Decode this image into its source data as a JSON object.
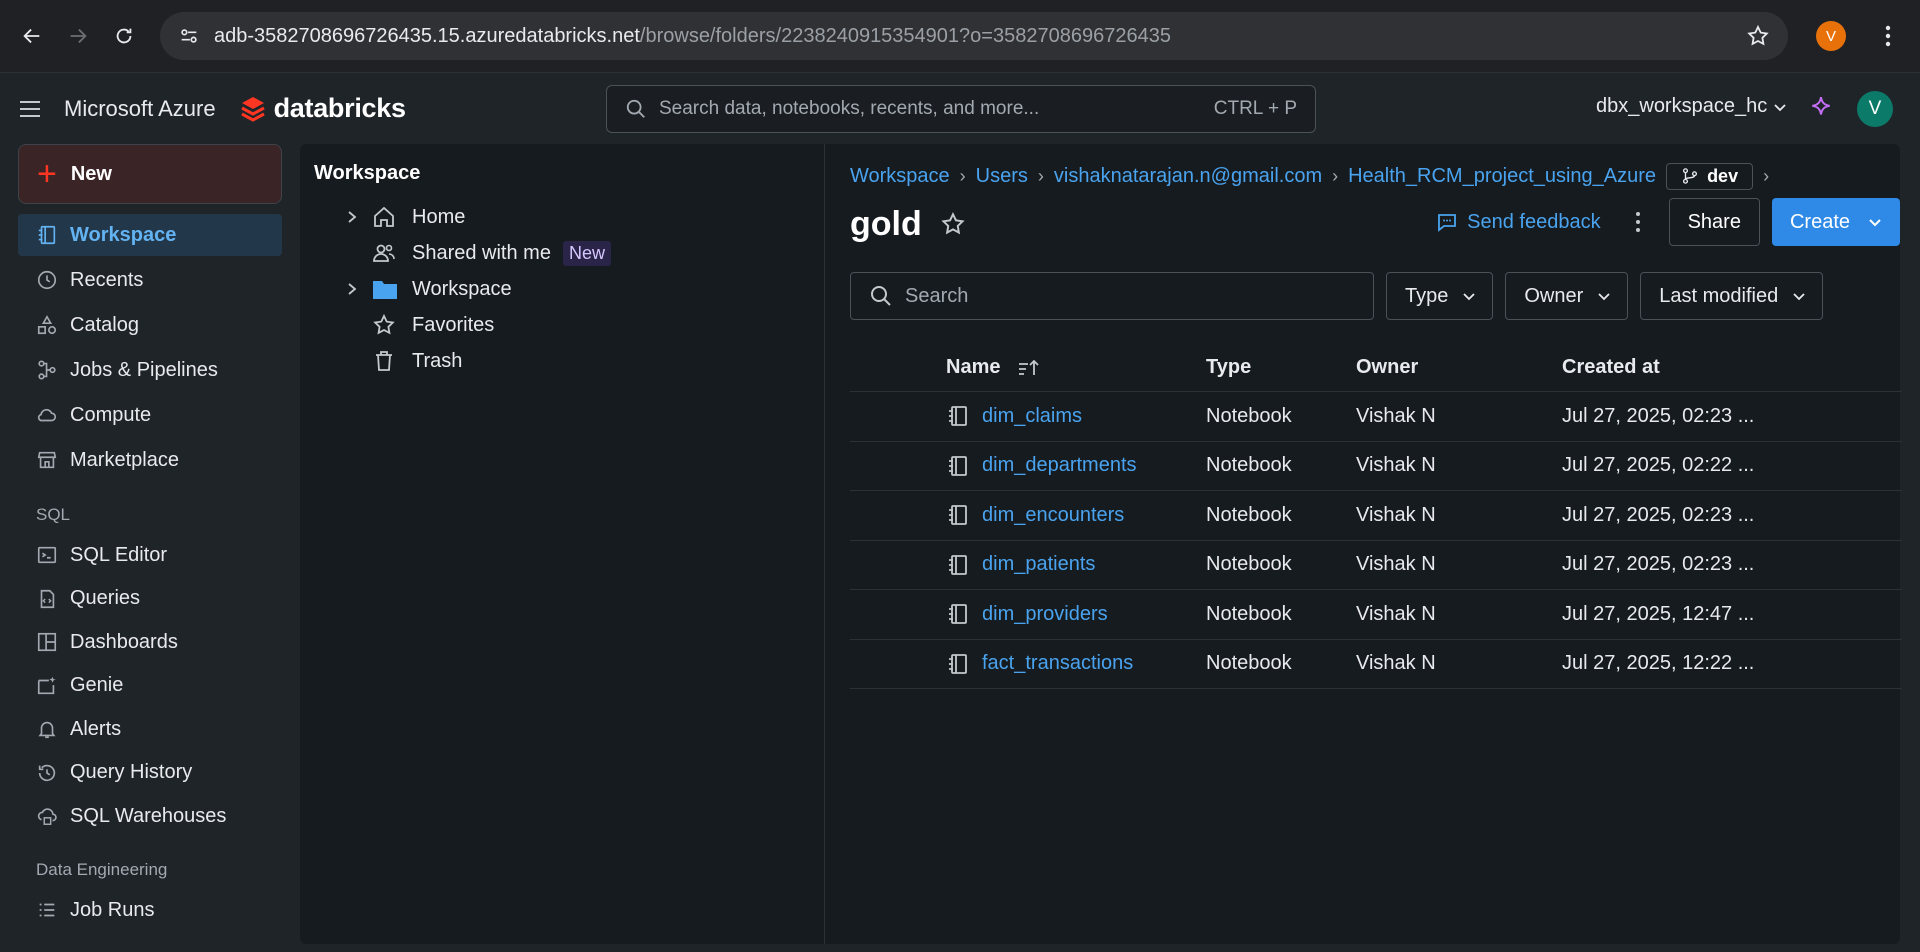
{
  "browser": {
    "url_host": "adb-3582708696726435.15.azuredatabricks.net",
    "url_path": "/browse/folders/2238240915354901?o=3582708696726435",
    "profile_initial": "V"
  },
  "header": {
    "brand": "Microsoft Azure",
    "logo_text": "databricks",
    "search_placeholder": "Search data, notebooks, recents, and more...",
    "search_shortcut": "CTRL + P",
    "workspace_name": "dbx_workspace_hc",
    "user_initial": "V"
  },
  "sidebar": {
    "new_label": "New",
    "items": [
      {
        "label": "Workspace",
        "icon": "workspace-icon",
        "active": true
      },
      {
        "label": "Recents",
        "icon": "clock-icon"
      },
      {
        "label": "Catalog",
        "icon": "catalog-icon"
      },
      {
        "label": "Jobs & Pipelines",
        "icon": "jobs-icon"
      },
      {
        "label": "Compute",
        "icon": "cloud-icon"
      },
      {
        "label": "Marketplace",
        "icon": "store-icon"
      }
    ],
    "sql_section": "SQL",
    "sql_items": [
      {
        "label": "SQL Editor",
        "icon": "terminal-icon"
      },
      {
        "label": "Queries",
        "icon": "file-code-icon"
      },
      {
        "label": "Dashboards",
        "icon": "dashboard-icon"
      },
      {
        "label": "Genie",
        "icon": "genie-icon"
      },
      {
        "label": "Alerts",
        "icon": "bell-icon"
      },
      {
        "label": "Query History",
        "icon": "history-icon"
      },
      {
        "label": "SQL Warehouses",
        "icon": "warehouse-icon"
      }
    ],
    "de_section": "Data Engineering",
    "de_items": [
      {
        "label": "Job Runs",
        "icon": "list-icon"
      }
    ]
  },
  "tree": {
    "title": "Workspace",
    "items": [
      {
        "label": "Home",
        "icon": "home-icon",
        "expandable": true
      },
      {
        "label": "Shared with me",
        "icon": "users-icon",
        "badge": "New"
      },
      {
        "label": "Workspace",
        "icon": "folder-icon",
        "expandable": true
      },
      {
        "label": "Favorites",
        "icon": "star-icon"
      },
      {
        "label": "Trash",
        "icon": "trash-icon"
      }
    ]
  },
  "pane": {
    "breadcrumb": [
      "Workspace",
      "Users",
      "vishaknatarajan.n@gmail.com",
      "Health_RCM_project_using_Azure"
    ],
    "branch": "dev",
    "title": "gold",
    "feedback": "Send feedback",
    "share": "Share",
    "create": "Create",
    "search_placeholder": "Search",
    "filters": [
      "Type",
      "Owner",
      "Last modified"
    ],
    "columns": {
      "name": "Name",
      "type": "Type",
      "owner": "Owner",
      "created": "Created at"
    },
    "rows": [
      {
        "name": "dim_claims",
        "type": "Notebook",
        "owner": "Vishak N",
        "created": "Jul 27, 2025, 02:23 ..."
      },
      {
        "name": "dim_departments",
        "type": "Notebook",
        "owner": "Vishak N",
        "created": "Jul 27, 2025, 02:22 ..."
      },
      {
        "name": "dim_encounters",
        "type": "Notebook",
        "owner": "Vishak N",
        "created": "Jul 27, 2025, 02:23 ..."
      },
      {
        "name": "dim_patients",
        "type": "Notebook",
        "owner": "Vishak N",
        "created": "Jul 27, 2025, 02:23 ..."
      },
      {
        "name": "dim_providers",
        "type": "Notebook",
        "owner": "Vishak N",
        "created": "Jul 27, 2025, 12:47 ..."
      },
      {
        "name": "fact_transactions",
        "type": "Notebook",
        "owner": "Vishak N",
        "created": "Jul 27, 2025, 12:22 ..."
      }
    ]
  },
  "colors": {
    "accent": "#4aa3ee",
    "brand_red": "#ff3621",
    "create_blue": "#2e8ae6"
  }
}
